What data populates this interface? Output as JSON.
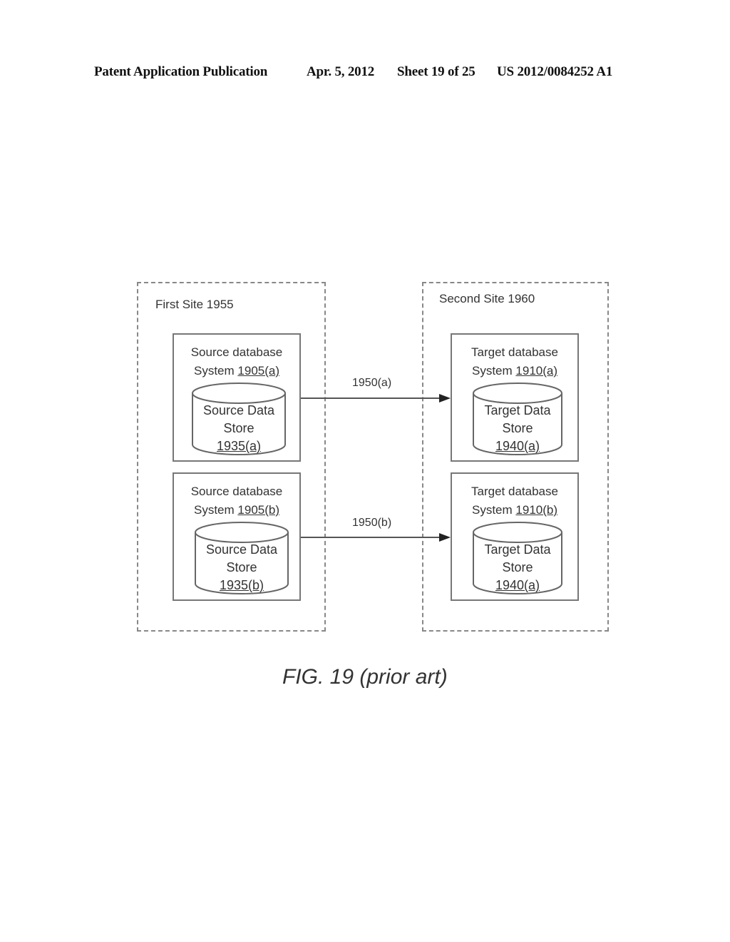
{
  "header": {
    "publication": "Patent Application Publication",
    "date": "Apr. 5, 2012",
    "sheet": "Sheet 19 of 25",
    "number": "US 2012/0084252 A1"
  },
  "sites": [
    {
      "label": "First Site 1955",
      "systems": [
        {
          "line1": "Source database",
          "line2": "System",
          "ref": "1905(a)",
          "store": {
            "line1": "Source Data",
            "line2": "Store",
            "ref": "1935(a)"
          }
        },
        {
          "line1": "Source database",
          "line2": "System",
          "ref": "1905(b)",
          "store": {
            "line1": "Source Data",
            "line2": "Store",
            "ref": "1935(b)"
          }
        }
      ]
    },
    {
      "label": "Second Site 1960",
      "systems": [
        {
          "line1": "Target database",
          "line2": "System",
          "ref": "1910(a)",
          "store": {
            "line1": "Target Data",
            "line2": "Store",
            "ref": "1940(a)"
          }
        },
        {
          "line1": "Target database",
          "line2": "System",
          "ref": "1910(b)",
          "store": {
            "line1": "Target Data",
            "line2": "Store",
            "ref": "1940(a)"
          }
        }
      ]
    }
  ],
  "connections": [
    {
      "label": "1950(a)",
      "from": "1905(a)",
      "to": "1910(a)"
    },
    {
      "label": "1950(b)",
      "from": "1905(b)",
      "to": "1910(b)"
    }
  ],
  "caption": "FIG. 19 (prior art)"
}
